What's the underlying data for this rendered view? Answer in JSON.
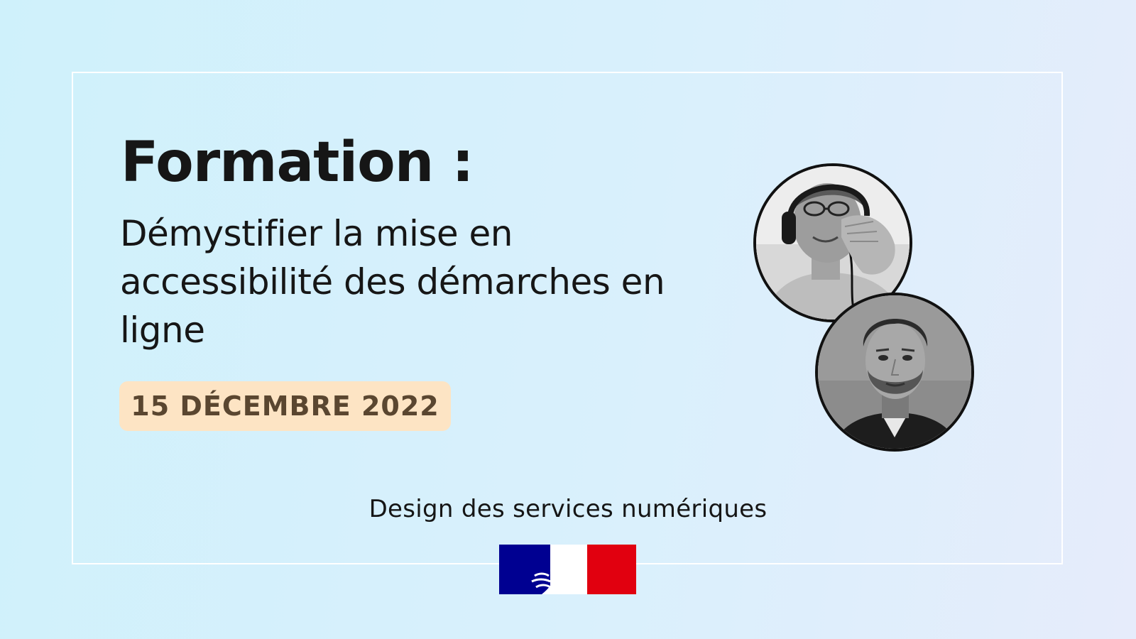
{
  "title": "Formation :",
  "subtitle": "Démystifier la mise en accessibilité des démarches en ligne",
  "date": "15 DÉCEMBRE 2022",
  "organization": "Design des services numériques",
  "colors": {
    "background": "#cff1fb",
    "date_badge": "#fde4c4",
    "flag_blue": "#000091",
    "flag_red": "#e1000f"
  },
  "icons": [
    "speaker-photo-1",
    "speaker-photo-2",
    "marianne-flag-logo"
  ]
}
